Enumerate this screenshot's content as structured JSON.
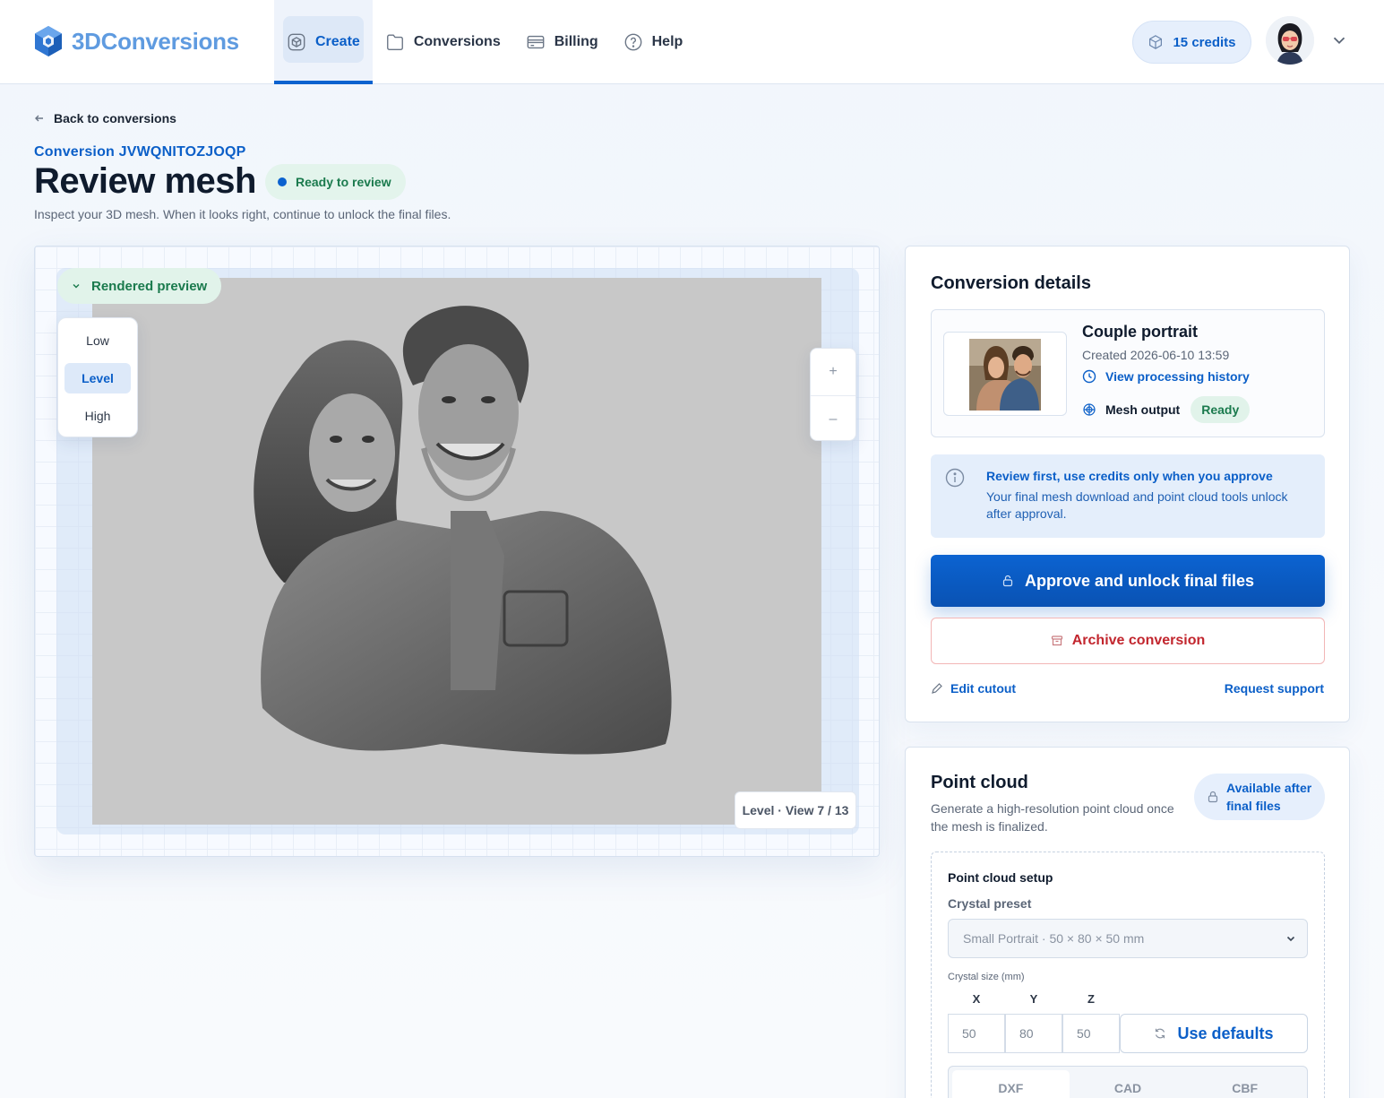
{
  "brand": {
    "name": "3DConversions"
  },
  "nav": {
    "items": [
      {
        "label": "Create",
        "icon": "box-3d-icon",
        "active": true
      },
      {
        "label": "Conversions",
        "icon": "folder-icon",
        "active": false
      },
      {
        "label": "Billing",
        "icon": "credit-card-icon",
        "active": false
      },
      {
        "label": "Help",
        "icon": "help-circle-icon",
        "active": false
      }
    ]
  },
  "header": {
    "credits_label": "15 credits"
  },
  "page": {
    "back_label": "Back to conversions",
    "conversion_id": "Conversion JVWQNITOZJOQP",
    "title": "Review mesh",
    "status": "Ready to review",
    "subtitle": "Inspect your 3D mesh. When it looks right, continue to unlock the final files."
  },
  "viewer": {
    "rendered_label": "Rendered preview",
    "levels": [
      "Low",
      "Level",
      "High"
    ],
    "active_level": "Level",
    "zoom_in": "+",
    "zoom_out": "–",
    "view_label": "Level · View 7 / 13"
  },
  "details": {
    "title": "Conversion details",
    "file_name": "Couple portrait",
    "created": "Created 2026-06-10 13:59",
    "history_link": "View processing history",
    "mesh_label": "Mesh output",
    "mesh_status": "Ready",
    "info_title": "Review first, use credits only when you approve",
    "info_text": "Your final mesh download and point cloud tools unlock after approval.",
    "approve_label": "Approve and unlock final files",
    "archive_label": "Archive conversion",
    "edit_label": "Edit cutout",
    "support_label": "Request support"
  },
  "point_cloud": {
    "title": "Point cloud",
    "description": "Generate a high-resolution point cloud once the mesh is finalized.",
    "badge_line1": "Available after",
    "badge_line2": "final files",
    "setup_title": "Point cloud setup",
    "preset_label": "Crystal preset",
    "preset_value": "Small Portrait · 50 × 80 × 50 mm",
    "size_label": "Crystal size (mm)",
    "axes": [
      "X",
      "Y",
      "Z"
    ],
    "sizes": [
      "50",
      "80",
      "50"
    ],
    "defaults_label": "Use defaults",
    "formats": [
      "DXF",
      "CAD",
      "CBF"
    ],
    "active_format": "DXF"
  },
  "colors": {
    "accent": "#0b5fc8",
    "success": "#1a7a4d",
    "danger": "#c2262e",
    "logo": "#5f9be0"
  }
}
